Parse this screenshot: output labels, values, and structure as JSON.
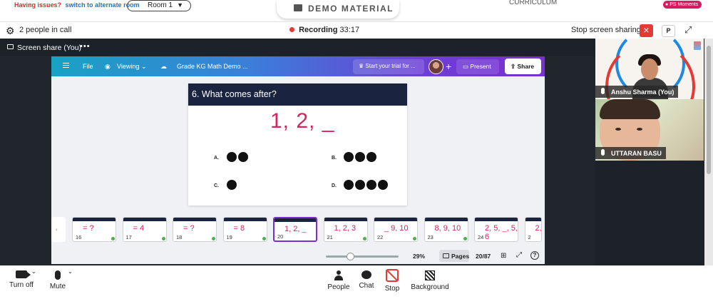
{
  "topbar": {
    "issues_text": "Having issues?",
    "alternate_link": "switch to alternate room",
    "room_value": "Room 1",
    "banner_title": "DEMO MATERIAL",
    "curriculum_label": "CURRICULUM",
    "ps_moments_label": "PS Moments"
  },
  "call": {
    "people_count": "2 people in call",
    "recording_label": "Recording",
    "recording_time": "33:17",
    "stop_sharing_label": "Stop screen sharing",
    "p_label": "P",
    "close_icon": "close-icon",
    "expand_icon": "expand-icon"
  },
  "screen_share": {
    "tab_label": "Screen share (You)",
    "more_label": "•••"
  },
  "canva": {
    "menu": {
      "file": "File",
      "viewing": "Viewing",
      "doc_title": "Grade KG Math Demo ...",
      "trial": "Start your trial for ...",
      "present": "Present",
      "share": "Share"
    },
    "slide": {
      "question": "6. What comes after?",
      "sequence": "1, 2, _",
      "options": [
        {
          "label": "A.",
          "dots": 2
        },
        {
          "label": "B.",
          "dots": 3
        },
        {
          "label": "C.",
          "dots": 1
        },
        {
          "label": "D.",
          "dots": 4
        }
      ]
    },
    "thumbnails": [
      {
        "num": "16",
        "content": "= ?",
        "active": false
      },
      {
        "num": "17",
        "content": "= 4",
        "active": false
      },
      {
        "num": "18",
        "content": "= ?",
        "active": false
      },
      {
        "num": "19",
        "content": "= 8",
        "active": false
      },
      {
        "num": "20",
        "content": "1, 2, _",
        "active": true
      },
      {
        "num": "21",
        "content": "1, 2, 3",
        "active": false
      },
      {
        "num": "22",
        "content": "_ 9, 10",
        "active": false
      },
      {
        "num": "23",
        "content": "8, 9, 10",
        "active": false
      },
      {
        "num": "24",
        "content": "2, 5, _, 5, 6",
        "active": false
      },
      {
        "num": "2",
        "content": "2,",
        "active": false
      }
    ],
    "footer": {
      "zoom": "29%",
      "pages_label": "Pages",
      "page_count": "20/87",
      "zoom_fraction": 0.29
    }
  },
  "participants": [
    {
      "name": "Anshu Sharma (You)"
    },
    {
      "name": "UTTARAN BASU"
    }
  ],
  "controls": {
    "turn_off": "Turn off",
    "mute": "Mute",
    "people": "People",
    "chat": "Chat",
    "stop": "Stop",
    "background": "Background"
  },
  "colors": {
    "accent_red": "#e53935",
    "slide_pink": "#d6245c",
    "slide_header": "#1a2340",
    "canva_purple": "#7a2fd0"
  }
}
